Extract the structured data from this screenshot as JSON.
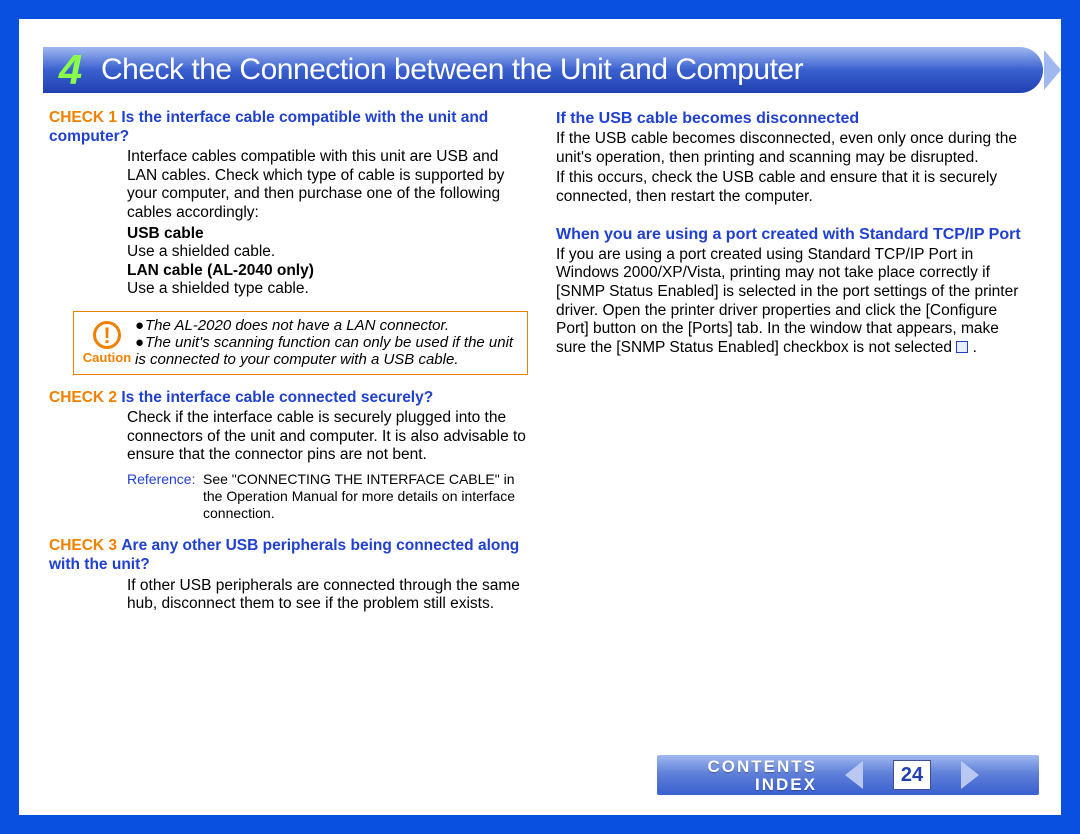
{
  "header": {
    "number": "4",
    "title": "Check the Connection between the Unit and Computer"
  },
  "left": {
    "check1": {
      "label": "CHECK 1",
      "title": "Is the interface cable compatible with the unit and computer?",
      "body": "Interface cables compatible with this unit are USB and LAN cables. Check which type of cable is supported by your computer, and then purchase one of the following cables accordingly:",
      "usb_label": "USB cable",
      "usb_body": "Use a shielded cable.",
      "lan_label": "LAN cable (AL-2040 only)",
      "lan_body": "Use a shielded type cable."
    },
    "caution": {
      "label": "Caution",
      "line1": "The AL-2020 does not have a LAN connector.",
      "line2": "The unit's scanning function can only be used if the unit is connected to your computer with a USB cable."
    },
    "check2": {
      "label": "CHECK 2",
      "title": "Is the interface cable connected securely?",
      "body": "Check if the interface cable is securely plugged into the connectors of the unit and computer. It is also advisable to ensure that the connector pins are not bent.",
      "ref_label": "Reference:",
      "ref_body": "See \"CONNECTING THE INTERFACE CABLE\" in the Operation Manual for more details on interface connection."
    },
    "check3": {
      "label": "CHECK 3",
      "title": "Are any other USB peripherals being connected along with the unit?",
      "body": "If other USB peripherals are connected through the same hub, disconnect them to see if the problem still exists."
    }
  },
  "right": {
    "sec1": {
      "title": "If the USB cable becomes disconnected",
      "p1": "If the USB cable becomes disconnected, even only once during the unit's operation, then printing and scanning may be disrupted.",
      "p2": "If this occurs, check the USB cable and ensure that it is securely connected, then restart the computer."
    },
    "sec2": {
      "title": "When you are using a port created with Standard TCP/IP Port",
      "p1a": "If you are using a port created using Standard TCP/IP Port in Windows 2000/XP/Vista, printing may not take place correctly if [SNMP Status Enabled] is selected in the port settings of the printer driver. Open the printer driver properties and click the [Configure Port] button on the [Ports] tab. In the window that appears, make sure the [SNMP Status Enabled] checkbox is not selected ",
      "p1b": " ."
    }
  },
  "nav": {
    "contents": "CONTENTS",
    "index": "INDEX",
    "page": "24"
  }
}
